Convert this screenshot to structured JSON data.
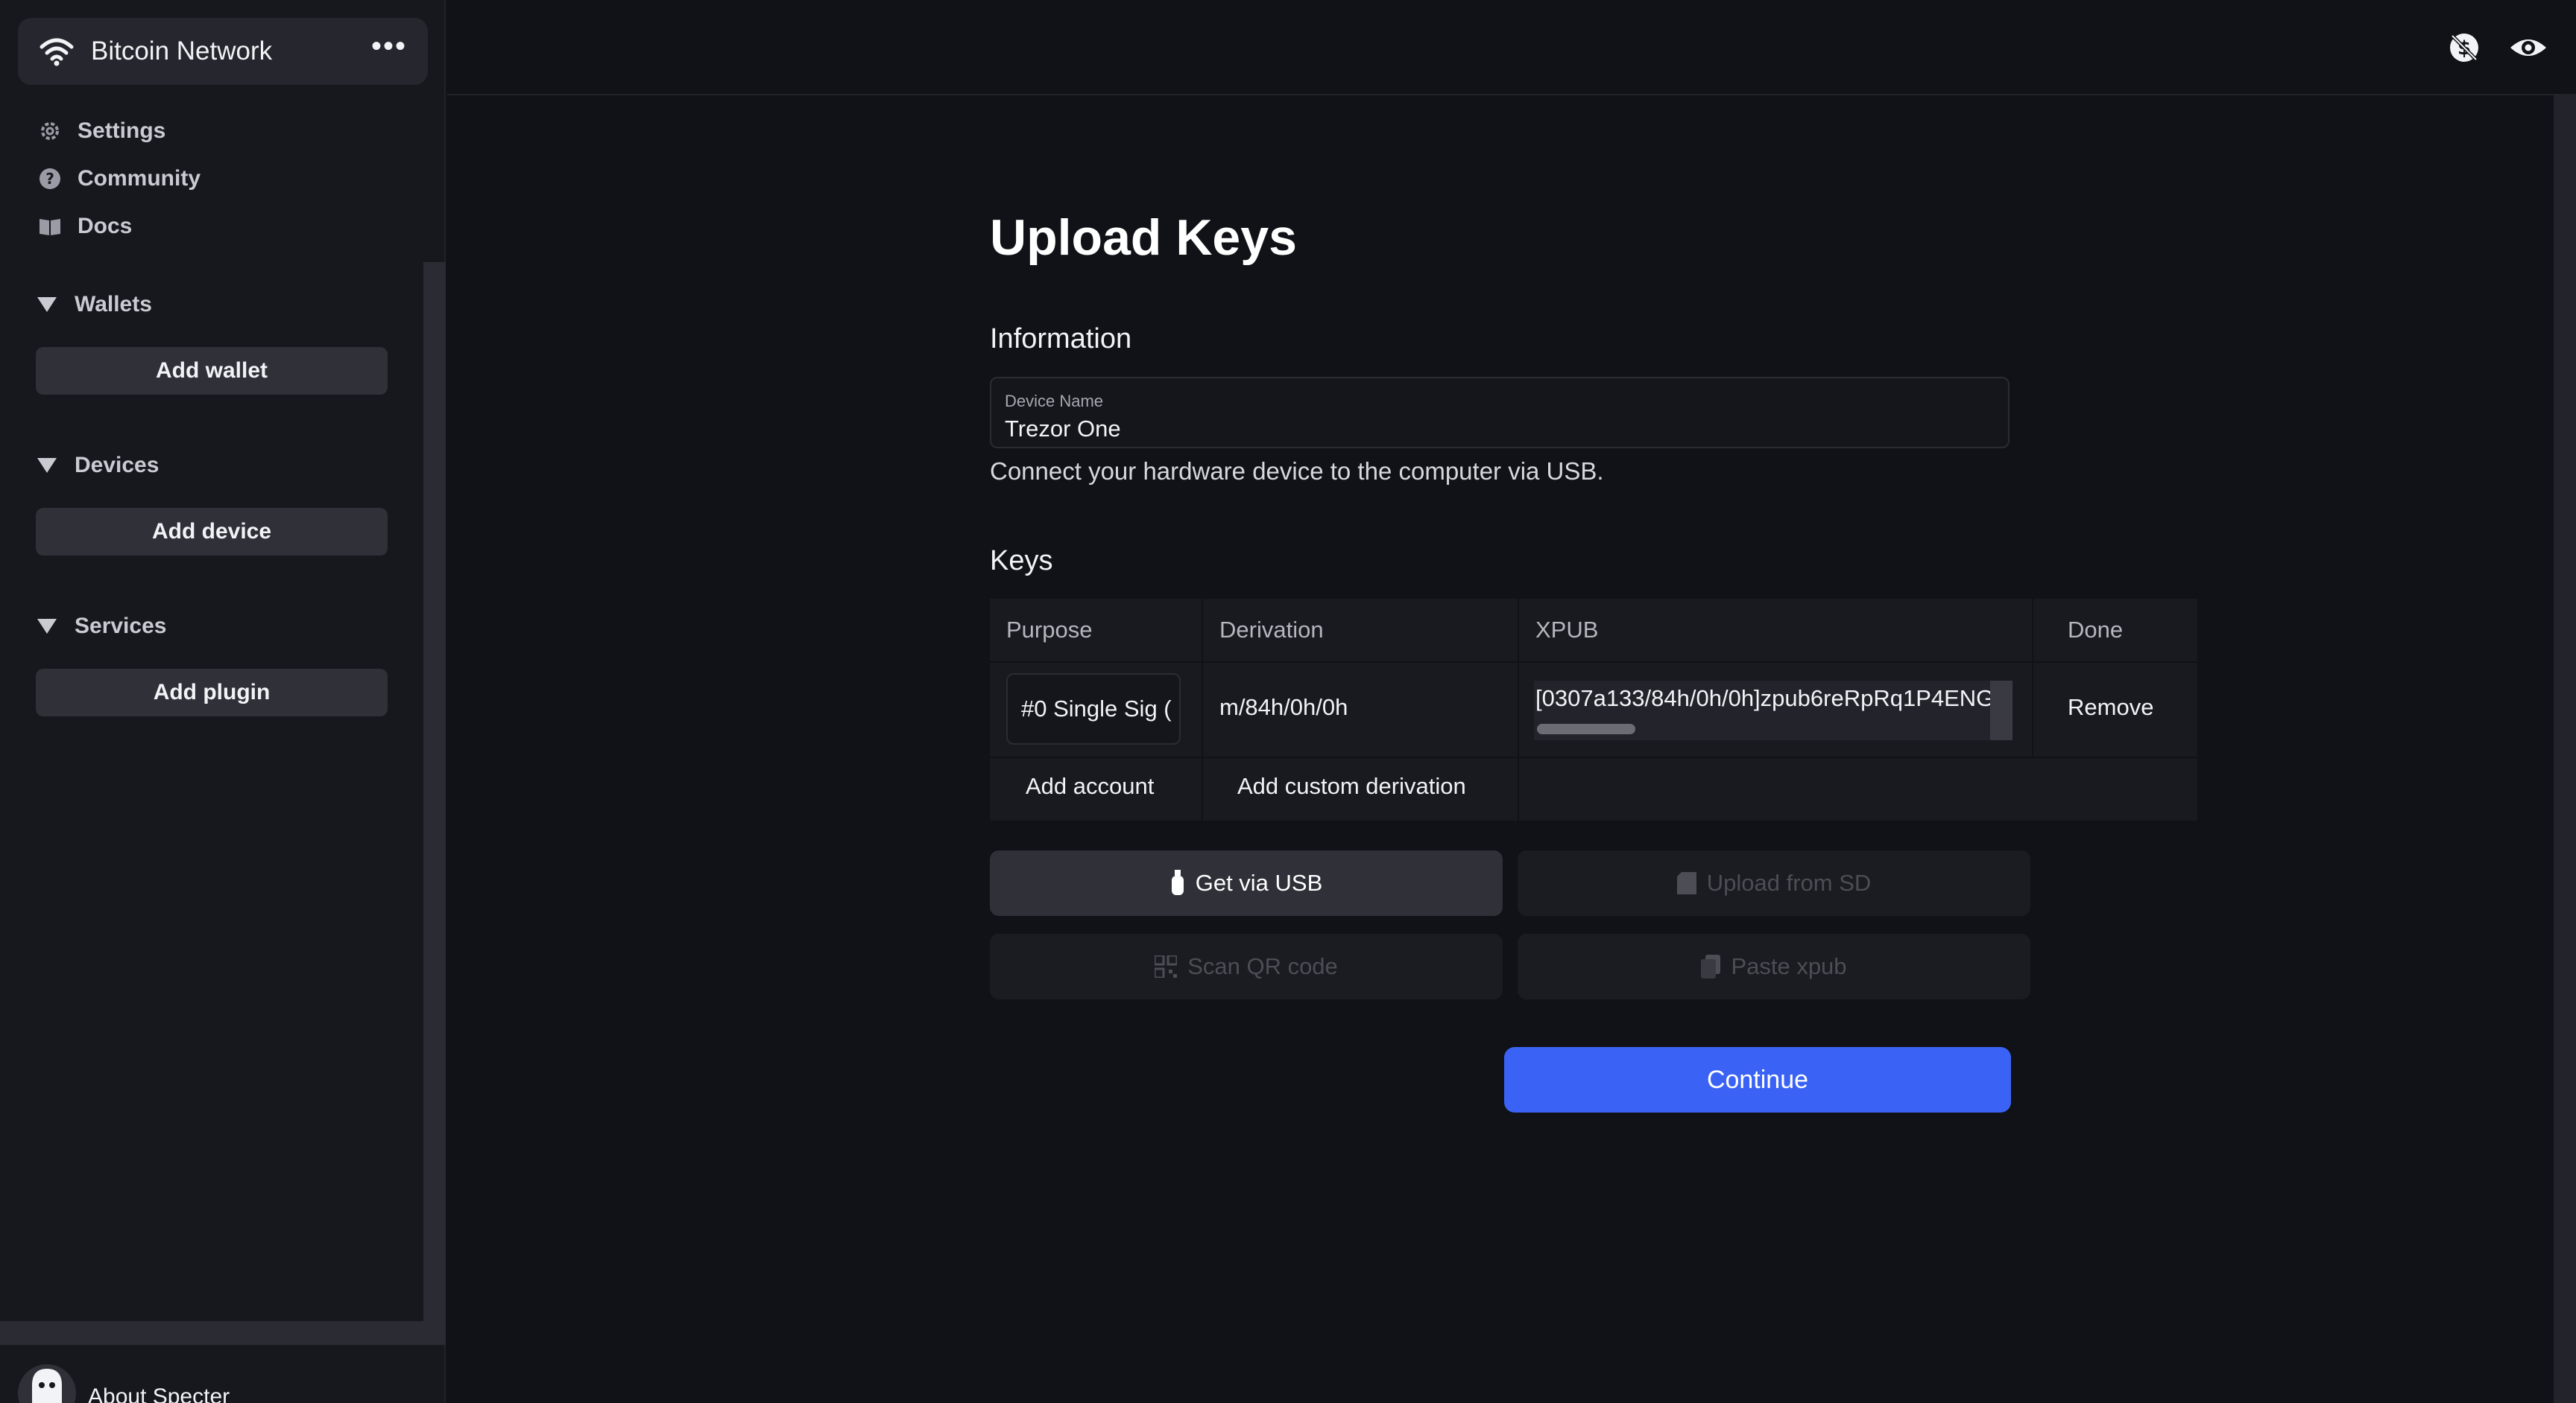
{
  "sidebar": {
    "network_label": "Bitcoin Network",
    "more_label": "•••",
    "nav": [
      {
        "label": "Settings",
        "icon": "gear-icon"
      },
      {
        "label": "Community",
        "icon": "question-icon"
      },
      {
        "label": "Docs",
        "icon": "book-icon"
      }
    ],
    "sections": [
      {
        "title": "Wallets",
        "button": "Add wallet"
      },
      {
        "title": "Devices",
        "button": "Add device"
      },
      {
        "title": "Services",
        "button": "Add plugin"
      }
    ],
    "about_label": "About Specter"
  },
  "topbar": {
    "icons": [
      "hide-balance-icon",
      "eye-icon"
    ]
  },
  "main": {
    "title": "Upload Keys",
    "information_title": "Information",
    "device_name_label": "Device Name",
    "device_name_value": "Trezor One",
    "hint": "Connect your hardware device to the computer via USB.",
    "keys_title": "Keys",
    "table": {
      "headers": [
        "Purpose",
        "Derivation",
        "XPUB",
        "Done"
      ],
      "rows": [
        {
          "purpose": "#0 Single Sig (",
          "derivation": "m/84h/0h/0h",
          "xpub": "[0307a133/84h/0h/0h]zpub6reRpRq1P4ENG",
          "action": "Remove"
        }
      ],
      "add_account": "Add account",
      "add_custom_derivation": "Add custom derivation"
    },
    "buttons": {
      "get_usb": "Get via USB",
      "upload_sd": "Upload from SD",
      "scan_qr": "Scan QR code",
      "paste_xpub": "Paste xpub",
      "continue": "Continue"
    }
  },
  "colors": {
    "background": "#111217",
    "sidebar": "#17181e",
    "accent": "#3a63f5"
  }
}
